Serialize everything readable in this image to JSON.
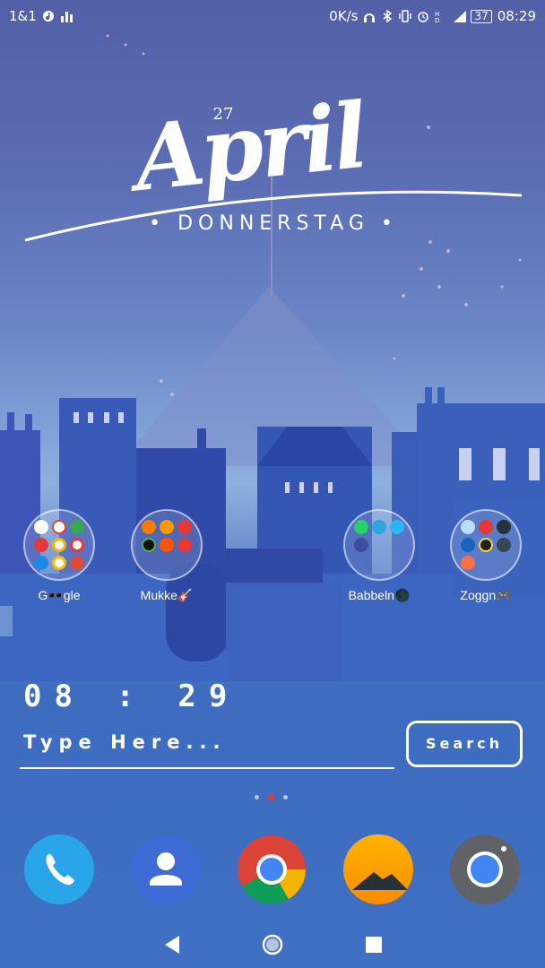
{
  "status_bar": {
    "carrier": "1&1",
    "speed": "0K/s",
    "battery": "37",
    "time": "08:29",
    "icons": [
      "music-icon",
      "signal-bars-icon",
      "headphones-icon",
      "bluetooth-icon",
      "vibrate-icon",
      "alarm-icon",
      "hd-icon",
      "signal-icon",
      "battery-icon"
    ]
  },
  "calendar_widget": {
    "day": "27",
    "month": "April",
    "weekday": "• DONNERSTAG •"
  },
  "folders": [
    {
      "label": "G🕶️gle",
      "apps": [
        "google",
        "gmail",
        "maps",
        "youtube",
        "drive",
        "play-store",
        "duo",
        "photos",
        "google-plus"
      ]
    },
    {
      "label": "Mukke🎸",
      "apps": [
        "media-player",
        "play-music",
        "apple-music",
        "music-app",
        "soundcloud",
        "podcast"
      ]
    },
    {
      "label": "Babbeln🌑",
      "apps": [
        "whatsapp",
        "telegram",
        "messages",
        "f-app"
      ]
    },
    {
      "label": "Zoggn🎮",
      "apps": [
        "game-1",
        "game-2",
        "game-3",
        "game-4",
        "game-5",
        "game-6",
        "game-7"
      ]
    }
  ],
  "clock_widget": {
    "time": "08 : 29"
  },
  "search_widget": {
    "placeholder": "Type Here...",
    "button_label": "Search"
  },
  "dock": [
    "phone",
    "contacts",
    "chrome",
    "gallery",
    "camera"
  ],
  "colors": {
    "phone": "#29a6ea",
    "contacts": "#3f6bd6",
    "chrome_red": "#db4437",
    "chrome_green": "#0f9d58",
    "chrome_yellow": "#f4b400",
    "chrome_blue": "#4285f4",
    "gallery_orange": "#fb8c00",
    "camera_gray": "#5f6368",
    "camera_blue": "#4285f4",
    "page_dot_active": "#e53935"
  },
  "nav_bar": [
    "back",
    "home",
    "recents"
  ]
}
